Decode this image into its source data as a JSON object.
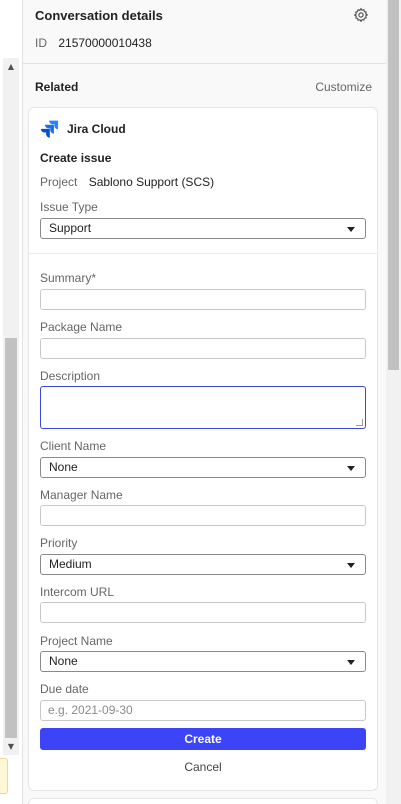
{
  "header": {
    "title": "Conversation details",
    "id_label": "ID",
    "id_value": "21570000010438"
  },
  "related": {
    "title": "Related",
    "customize_label": "Customize"
  },
  "app": {
    "name": "Jira Cloud",
    "logo_color": "#2684ff"
  },
  "form": {
    "title": "Create issue",
    "project_label": "Project",
    "project_value": "Sablono Support (SCS)",
    "issue_type_label": "Issue Type",
    "issue_type_value": "Support",
    "summary_label": "Summary*",
    "summary_value": "",
    "package_name_label": "Package Name",
    "package_name_value": "",
    "description_label": "Description",
    "description_value": "",
    "client_name_label": "Client Name",
    "client_name_value": "None",
    "manager_name_label": "Manager Name",
    "manager_name_value": "",
    "priority_label": "Priority",
    "priority_value": "Medium",
    "intercom_url_label": "Intercom URL",
    "intercom_url_value": "",
    "project_name_label": "Project Name",
    "project_name_value": "None",
    "due_date_label": "Due date",
    "due_date_placeholder": "e.g. 2021-09-30",
    "create_label": "Create",
    "cancel_label": "Cancel"
  },
  "colors": {
    "primary_button": "#3b44f6",
    "focus_border": "#3b4bd8"
  }
}
